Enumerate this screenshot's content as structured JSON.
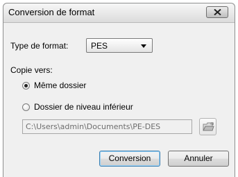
{
  "window": {
    "title": "Conversion de format"
  },
  "format": {
    "label": "Type de format:",
    "selected": "PES"
  },
  "copy": {
    "label": "Copie vers:",
    "options": [
      {
        "label": "Même dossier",
        "selected": true
      },
      {
        "label": "Dossier de niveau inférieur",
        "selected": false
      }
    ],
    "path": "C:\\Users\\admin\\Documents\\PE-DES"
  },
  "buttons": {
    "convert": "Conversion",
    "cancel": "Annuler"
  }
}
